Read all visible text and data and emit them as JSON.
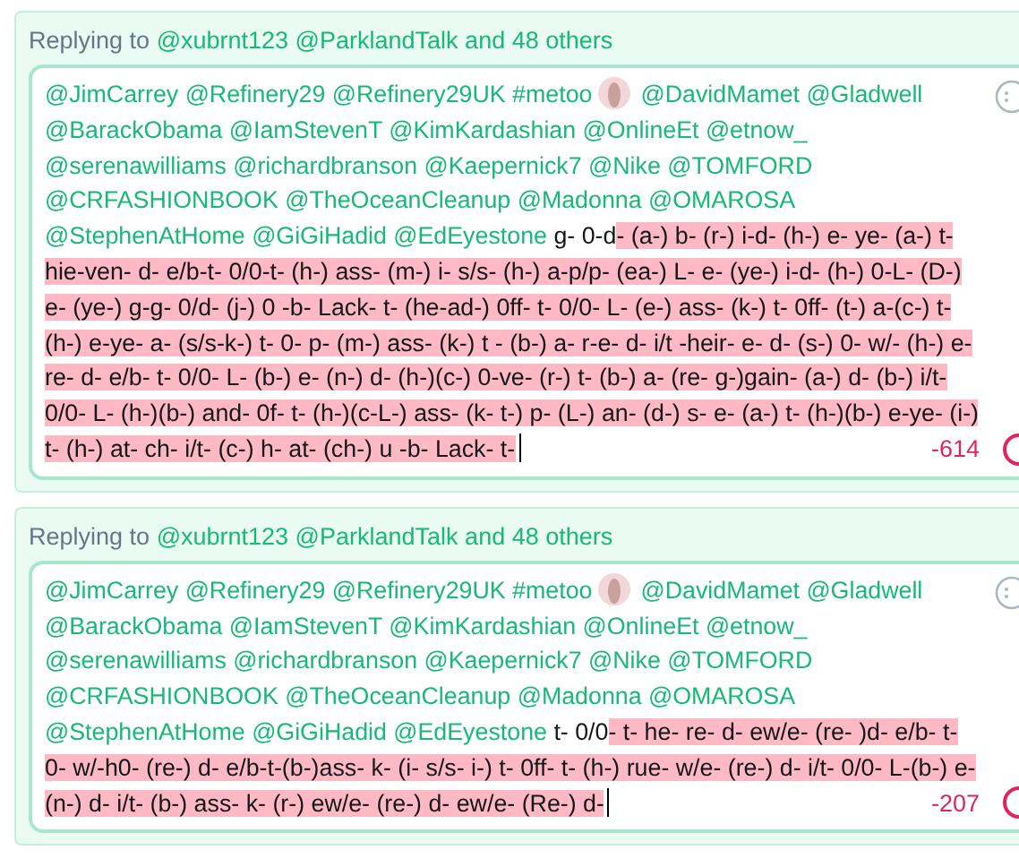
{
  "replies": [
    {
      "replying_prefix": "Replying to",
      "replying_to": "@xubrnt123 @ParklandTalk and 48 others",
      "mentions_before": "@JimCarrey @Refinery29 @Refinery29UK #metoo",
      "mentions_after": "@DavidMamet @Gladwell @BarackObama @IamStevenT @KimKardashian  @OnlineEt @etnow_ @serenawilliams @richardbranson @Kaepernick7 @Nike @TOMFORD @CRFASHIONBOOK @TheOceanCleanup @Madonna @OMAROSA @StephenAtHome @GiGiHadid @EdEyestone",
      "text_within": "g- 0-d",
      "text_over": "- (a-) b- (r-) i-d- (h-) e- ye- (a-) t- hie-ven- d- e/b-t- 0/0-t- (h-) ass- (m-) i- s/s- (h-) a-p/p- (ea-) L- e- (ye-) i-d- (h-) 0-L- (D-) e- (ye-) g-g- 0/d- (j-) 0 -b- Lack- t-  (he-ad-) 0ff- t- 0/0- L- (e-) ass- (k-) t- 0ff- (t-) a-(c-) t-  (h-) e-ye- a- (s/s-k-) t- 0- p- (m-) ass- (k-) t - (b-) a- r-e- d- i/t -heir- e- d- (s-) 0- w/- (h-) e- re- d-  e/b- t- 0/0- L- (b-) e- (n-) d- (h-)(c-) 0-ve- (r-) t- (b-) a- (re- g-)gain- (a-) d-  (b-) i/t- 0/0- L- (h-)(b-) and-  0f- t- (h-)(c-L-) ass- (k- t-) p- (L-) an- (d-) s-  e- (a-) t- (h-)(b-) e-ye- (i-) t-  (h-) at-  ch- i/t- (c-) h- at-  (ch-) u -b- Lack- t-",
      "counter": "-614"
    },
    {
      "replying_prefix": "Replying to",
      "replying_to": "@xubrnt123 @ParklandTalk and 48 others",
      "mentions_before": "@JimCarrey @Refinery29 @Refinery29UK #metoo",
      "mentions_after": "@DavidMamet @Gladwell @BarackObama @IamStevenT @KimKardashian  @OnlineEt @etnow_ @serenawilliams @richardbranson @Kaepernick7 @Nike @TOMFORD @CRFASHIONBOOK @TheOceanCleanup @Madonna @OMAROSA @StephenAtHome @GiGiHadid @EdEyestone",
      "text_within": "t- 0/0",
      "text_over": "- t- he- re- d- ew/e- (re- )d- e/b- t- 0- w/-h0- (re-) d- e/b-t-(b-)ass- k- (i- s/s- i-) t- 0ff- t- (h-) rue- w/e- (re-) d-   i/t- 0/0- L-(b-) e- (n-) d- i/t- (b-) ass- k- (r-) ew/e- (re-) d- ew/e- (Re-) d-",
      "counter": "-207"
    }
  ]
}
